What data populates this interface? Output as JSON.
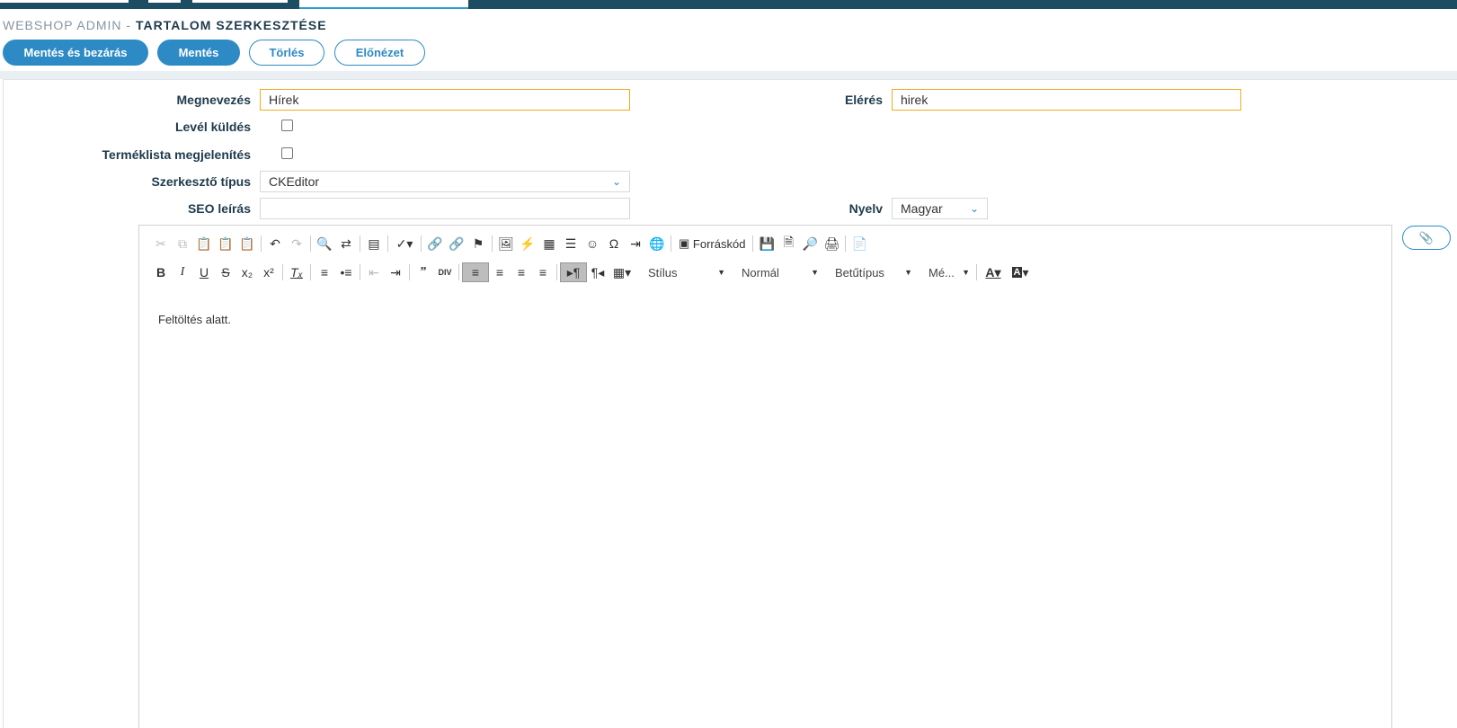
{
  "header": {
    "prefix": "WEBSHOP ADMIN -",
    "title": "TARTALOM SZERKESZTÉSE"
  },
  "actions": {
    "save_close": "Mentés és bezárás",
    "save": "Mentés",
    "delete": "Törlés",
    "preview": "Előnézet"
  },
  "form": {
    "name_label": "Megnevezés",
    "name_value": "Hírek",
    "path_label": "Elérés",
    "path_value": "hirek",
    "send_mail_label": "Levél küldés",
    "send_mail_checked": false,
    "product_list_label": "Terméklista megjelenítés",
    "product_list_checked": false,
    "editor_type_label": "Szerkesztő típus",
    "editor_type_value": "CKEditor",
    "seo_label": "SEO leírás",
    "seo_value": "",
    "lang_label": "Nyelv",
    "lang_value": "Magyar"
  },
  "editor": {
    "source_label": "Forráskód",
    "style_combo": "Stílus",
    "format_combo": "Normál",
    "font_combo": "Betűtípus",
    "size_combo": "Mé...",
    "body_text": "Feltöltés alatt."
  },
  "icons": {
    "attach": "paperclip-icon"
  }
}
